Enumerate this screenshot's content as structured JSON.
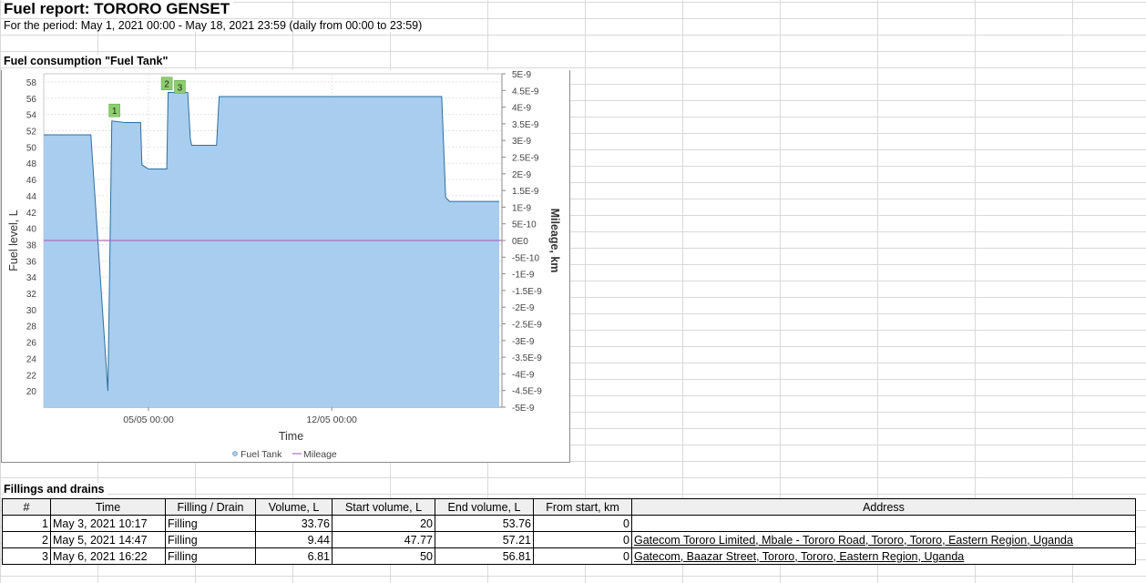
{
  "report": {
    "title": "Fuel report: TORORO GENSET",
    "period": "For the period: May 1, 2021 00:00 - May 18, 2021 23:59 (daily from 00:00 to 23:59)"
  },
  "chart_section": {
    "title": "Fuel consumption \"Fuel Tank\""
  },
  "chart_data": {
    "type": "area",
    "title": "",
    "xlabel": "Time",
    "ylabel": "Fuel level, L",
    "y2label": "Mileage, km",
    "ylim": [
      18,
      59
    ],
    "y2lim": [
      -5e-09,
      5e-09
    ],
    "x_ticks": [
      "05/05 00:00",
      "12/05 00:00"
    ],
    "y_ticks": [
      "20",
      "22",
      "24",
      "26",
      "28",
      "30",
      "32",
      "34",
      "36",
      "38",
      "40",
      "42",
      "44",
      "46",
      "48",
      "50",
      "52",
      "54",
      "56",
      "58"
    ],
    "y2_ticks": [
      "5E-9",
      "4.5E-9",
      "4E-9",
      "3.5E-9",
      "3E-9",
      "2.5E-9",
      "2E-9",
      "1.5E-9",
      "1E-9",
      "5E-10",
      "0E0",
      "-5E-10",
      "-1E-9",
      "-1.5E-9",
      "-2E-9",
      "-2.5E-9",
      "-3E-9",
      "-3.5E-9",
      "-4E-9",
      "-4.5E-9",
      "-5E-9"
    ],
    "grid": true,
    "legend_position": "bottom",
    "series": [
      {
        "name": "Fuel Tank",
        "color": "#a8cdee",
        "line_color": "#2b6f9e",
        "x_days": [
          0.0,
          0.3,
          1.8,
          2.45,
          2.6,
          3.1,
          3.7,
          3.75,
          4.0,
          4.7,
          4.75,
          5.5,
          5.6,
          5.65,
          5.75,
          6.6,
          6.7,
          15.2,
          15.35,
          15.5,
          17.4
        ],
        "values": [
          51.5,
          51.5,
          51.5,
          20.0,
          53.2,
          53.0,
          53.0,
          47.8,
          47.3,
          47.3,
          56.7,
          56.7,
          51.0,
          50.2,
          50.2,
          50.2,
          56.2,
          56.2,
          43.8,
          43.3,
          43.3
        ]
      },
      {
        "name": "Mileage",
        "color": "#b06cc0",
        "values_constant": 0
      }
    ],
    "markers": [
      {
        "label": "1",
        "x_day": 2.7,
        "value": 54.5
      },
      {
        "label": "2",
        "x_day": 4.7,
        "value": 57.8
      },
      {
        "label": "3",
        "x_day": 5.2,
        "value": 57.4
      }
    ]
  },
  "fillings": {
    "title": "Fillings and drains",
    "headers": [
      "#",
      "Time",
      "Filling / Drain",
      "Volume, L",
      "Start volume, L",
      "End volume, L",
      "From start, km",
      "Address"
    ],
    "rows": [
      {
        "num": "1",
        "time": "May 3, 2021 10:17",
        "type": "Filling",
        "volume": "33.76",
        "start": "20",
        "end": "53.76",
        "km": "0",
        "address": ""
      },
      {
        "num": "2",
        "time": "May 5, 2021 14:47",
        "type": "Filling",
        "volume": "9.44",
        "start": "47.77",
        "end": "57.21",
        "km": "0",
        "address": "Gatecom Tororo Limited, Mbale - Tororo Road, Tororo, Tororo, Eastern Region, Uganda"
      },
      {
        "num": "3",
        "time": "May 6, 2021 16:22",
        "type": "Filling",
        "volume": "6.81",
        "start": "50",
        "end": "56.81",
        "km": "0",
        "address": "Gatecom, Baazar Street, Tororo, Tororo, Eastern Region, Uganda"
      }
    ]
  }
}
